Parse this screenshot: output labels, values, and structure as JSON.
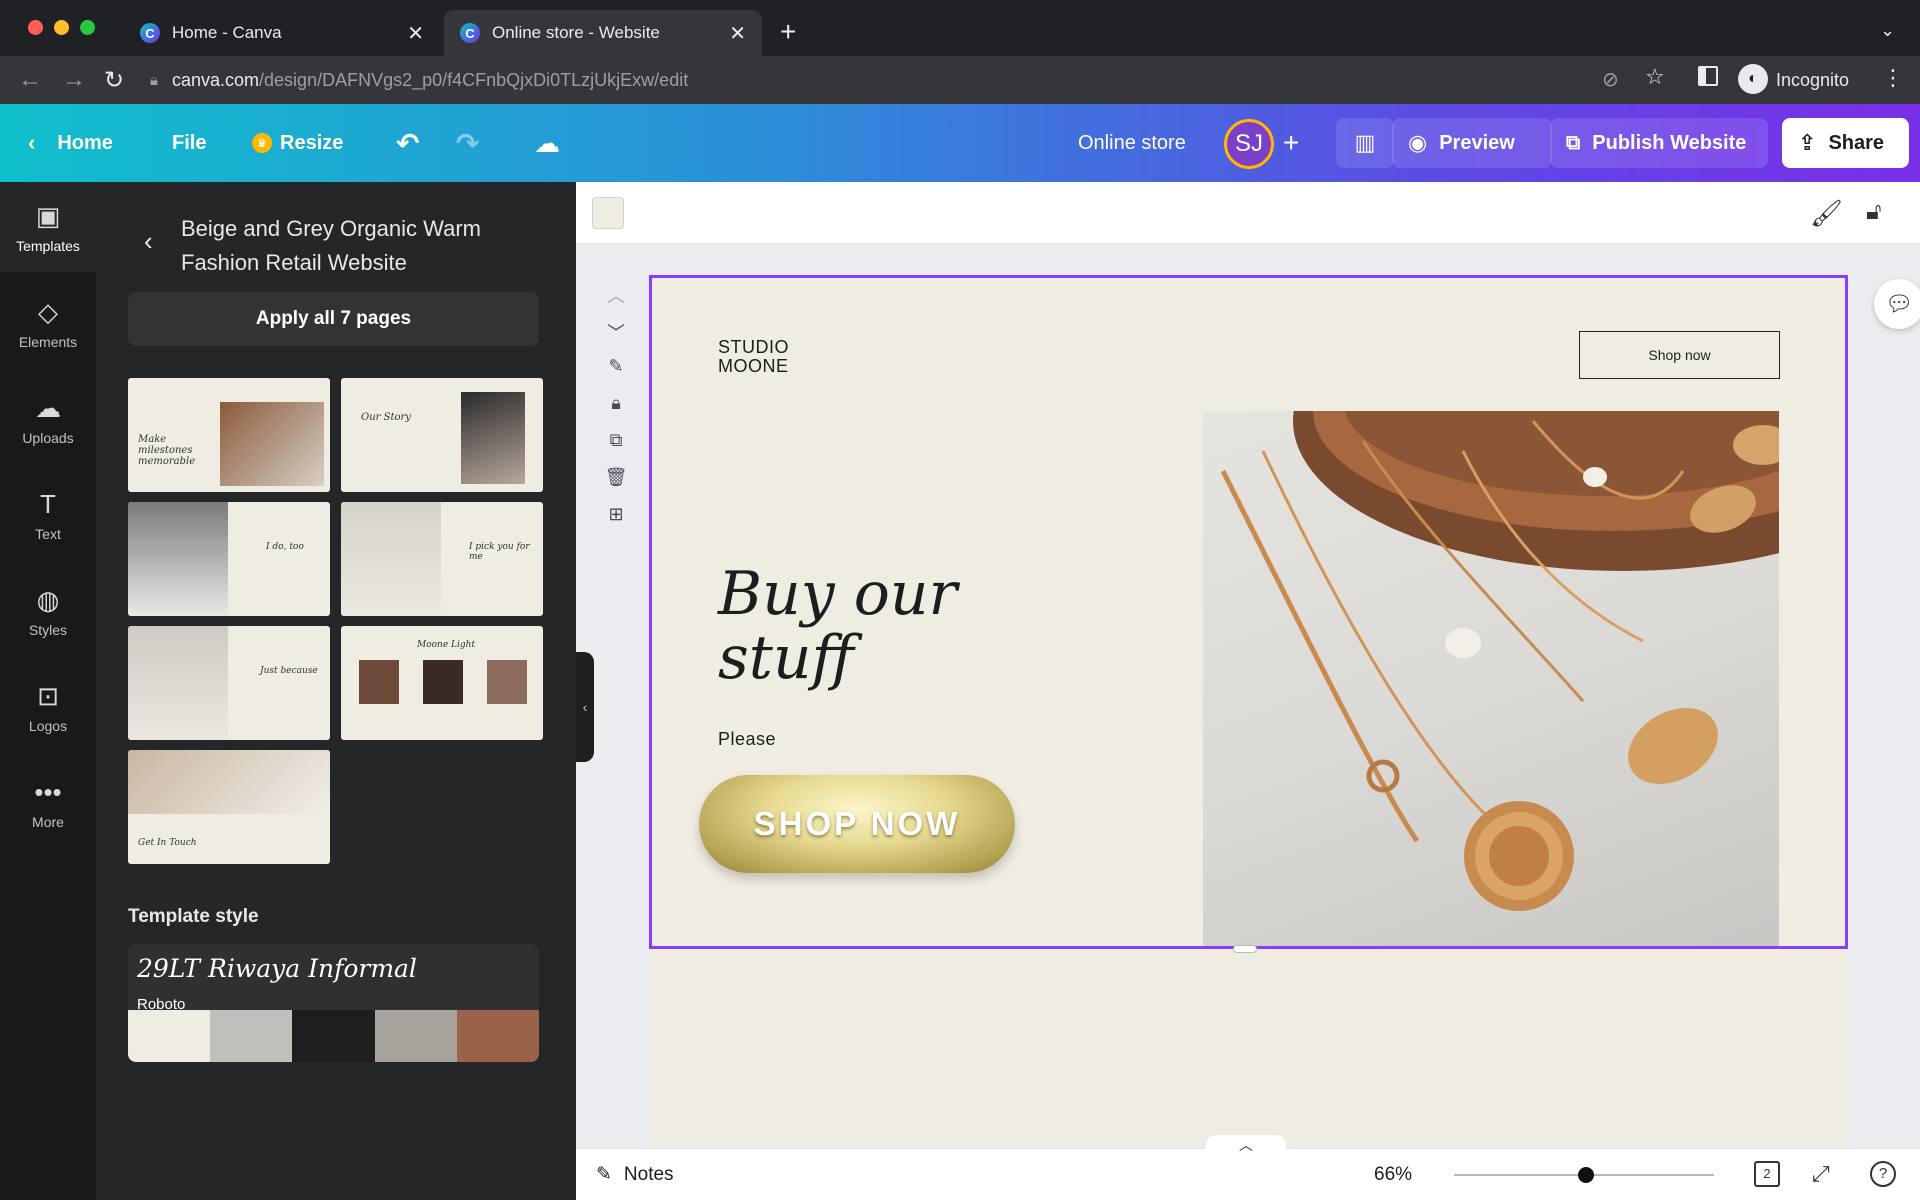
{
  "browser": {
    "tabs": [
      {
        "title": "Home - Canva",
        "favicon": "C"
      },
      {
        "title": "Online store - Website",
        "favicon": "C"
      }
    ],
    "url_host": "canva.com",
    "url_path": "/design/DAFNVgs2_p0/f4CFnbQjxDi0TLzjUkjExw/edit",
    "incognito_label": "Incognito"
  },
  "topbar": {
    "home_label": "Home",
    "file_label": "File",
    "resize_label": "Resize",
    "doc_title": "Online store",
    "avatar_initials": "SJ",
    "preview_label": "Preview",
    "publish_label": "Publish Website",
    "share_label": "Share"
  },
  "rail": {
    "items": [
      {
        "label": "Templates",
        "icon": "layout-icon"
      },
      {
        "label": "Elements",
        "icon": "shapes-icon"
      },
      {
        "label": "Uploads",
        "icon": "cloud-upload-icon"
      },
      {
        "label": "Text",
        "icon": "text-icon"
      },
      {
        "label": "Styles",
        "icon": "palette-icon"
      },
      {
        "label": "Logos",
        "icon": "logo-icon"
      },
      {
        "label": "More",
        "icon": "more-icon"
      }
    ]
  },
  "panel": {
    "title": "Beige and Grey Organic Warm Fashion Retail Website",
    "apply_label": "Apply all 7 pages",
    "thumbs": [
      {
        "text": "Make milestones memorable"
      },
      {
        "text": "Our Story"
      },
      {
        "text": "I do, too"
      },
      {
        "text": "I pick you for me"
      },
      {
        "text": "Just because"
      },
      {
        "text": "Moone Light"
      },
      {
        "text": "Get In Touch"
      }
    ],
    "template_style_label": "Template style",
    "heading_font": "29LT Riwaya Informal",
    "body_font": "Roboto",
    "palette": [
      "#efece1",
      "#bfbfbc",
      "#1e1e1e",
      "#a8a29c",
      "#9a6248"
    ]
  },
  "canvas": {
    "brand_line1": "STUDIO",
    "brand_line2": "MOONE",
    "header_button": "Shop now",
    "headline_line1": "Buy our",
    "headline_line2": "stuff",
    "subtext": "Please",
    "cta_label": "SHOP NOW"
  },
  "footer": {
    "notes_label": "Notes",
    "zoom_label": "66%",
    "zoom_level": 0.66,
    "page_count": "2"
  }
}
